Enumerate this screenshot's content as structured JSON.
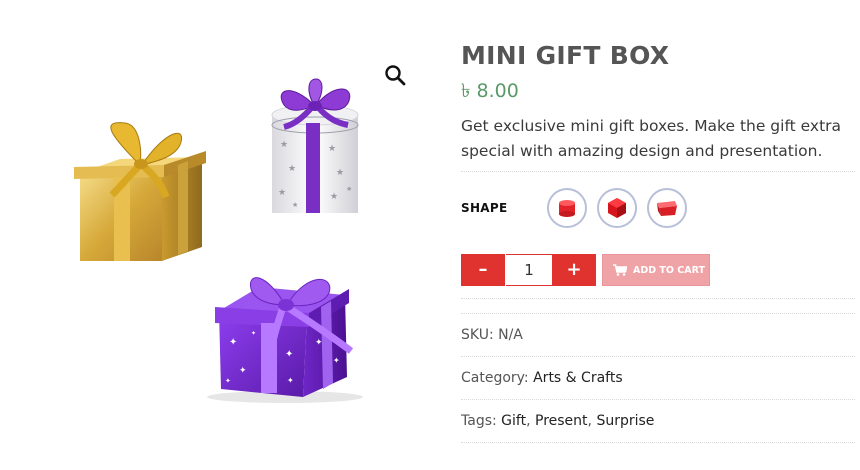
{
  "product": {
    "title": "MINI GIFT BOX",
    "price": "৳ 8.00",
    "description": "Get exclusive mini gift boxes. Make the gift extra special with amazing design and presentation."
  },
  "gallery": {
    "zoom_icon": "magnifier-icon",
    "images": [
      "gold-gift-box",
      "silver-star-round-gift-box",
      "purple-sparkle-gift-box"
    ]
  },
  "shape": {
    "label": "SHAPE",
    "options": [
      "cylinder",
      "cube",
      "box"
    ]
  },
  "cart": {
    "minus_label": "–",
    "quantity": "1",
    "plus_label": "+",
    "add_to_cart_label": "ADD TO CART",
    "cart_icon": "cart-icon"
  },
  "meta": {
    "sku_label": "SKU:",
    "sku_value": "N/A",
    "category_label": "Category:",
    "category_value": "Arts & Crafts",
    "tags_label": "Tags:",
    "tags": [
      "Gift",
      "Present",
      "Surprise"
    ],
    "tag_separator": ", "
  },
  "colors": {
    "accent_red": "#e0332f",
    "price_green": "#5b9a68",
    "disabled_cart": "#f0a3a6"
  }
}
